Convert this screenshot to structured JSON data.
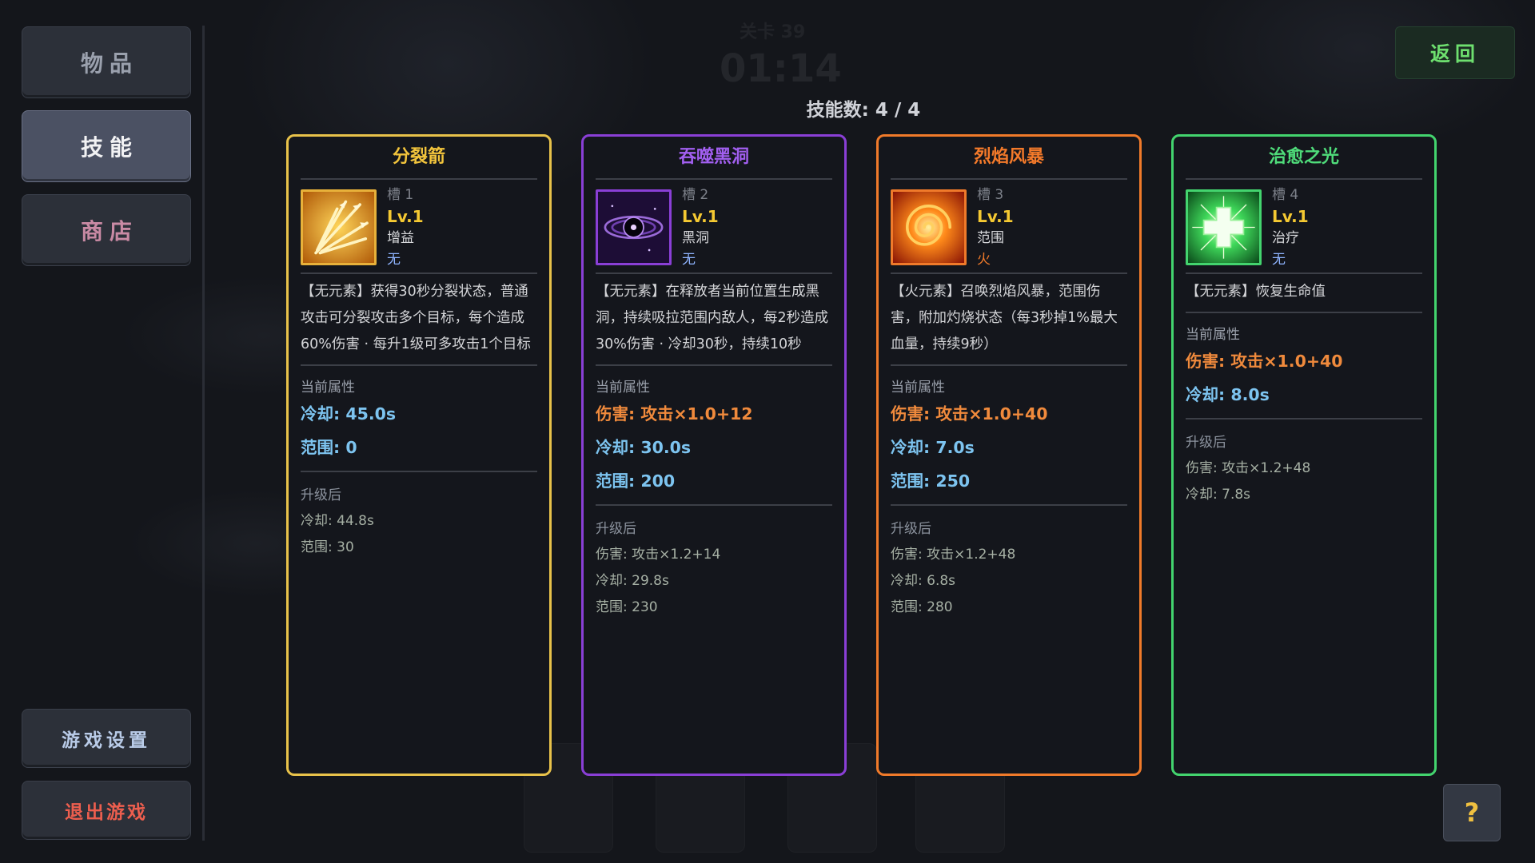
{
  "sidebar": {
    "items_label": "物品",
    "skills_label": "技能",
    "shop_label": "商店",
    "settings_label": "游戏设置",
    "exit_label": "退出游戏"
  },
  "header": {
    "back_label": "返回",
    "skill_count": "技能数: 4 / 4",
    "ghost_label": "关卡 39",
    "ghost_timer": "01:14"
  },
  "help_label": "?",
  "sections": {
    "current": "当前属性",
    "upgrade": "升级后"
  },
  "colors": {
    "slot1_border": "#e8c24a",
    "slot2_border": "#8a3fd6",
    "slot3_border": "#f07a2a",
    "slot4_border": "#43d46e"
  },
  "skills": [
    {
      "name": "分裂箭",
      "slot": "槽 1",
      "level": "Lv.1",
      "type": "增益",
      "element": "无",
      "icon": "split-arrow-icon",
      "description": "【无元素】获得30秒分裂状态，普通攻击可分裂攻击多个目标，每个造成60%伤害 · 每升1级可多攻击1个目标",
      "current": {
        "cooldown": "冷却: 45.0s",
        "range": "范围: 0"
      },
      "upgrade": {
        "cooldown": "冷却: 44.8s",
        "range": "范围: 30"
      }
    },
    {
      "name": "吞噬黑洞",
      "slot": "槽 2",
      "level": "Lv.1",
      "type": "黑洞",
      "element": "无",
      "icon": "black-hole-icon",
      "description": "【无元素】在释放者当前位置生成黑洞，持续吸拉范围内敌人，每2秒造成30%伤害 · 冷却30秒，持续10秒",
      "current": {
        "damage": "伤害: 攻击×1.0+12",
        "cooldown": "冷却: 30.0s",
        "range": "范围: 200"
      },
      "upgrade": {
        "damage": "伤害: 攻击×1.2+14",
        "cooldown": "冷却: 29.8s",
        "range": "范围: 230"
      }
    },
    {
      "name": "烈焰风暴",
      "slot": "槽 3",
      "level": "Lv.1",
      "type": "范围",
      "element": "火",
      "icon": "fire-storm-icon",
      "description": "【火元素】召唤烈焰风暴，范围伤害，附加灼烧状态（每3秒掉1%最大血量，持续9秒）",
      "current": {
        "damage": "伤害: 攻击×1.0+40",
        "cooldown": "冷却: 7.0s",
        "range": "范围: 250"
      },
      "upgrade": {
        "damage": "伤害: 攻击×1.2+48",
        "cooldown": "冷却: 6.8s",
        "range": "范围: 280"
      }
    },
    {
      "name": "治愈之光",
      "slot": "槽 4",
      "level": "Lv.1",
      "type": "治疗",
      "element": "无",
      "icon": "healing-cross-icon",
      "description": "【无元素】恢复生命值",
      "current": {
        "damage": "伤害: 攻击×1.0+40",
        "cooldown": "冷却: 8.0s"
      },
      "upgrade": {
        "damage": "伤害: 攻击×1.2+48",
        "cooldown": "冷却: 7.8s"
      }
    }
  ]
}
